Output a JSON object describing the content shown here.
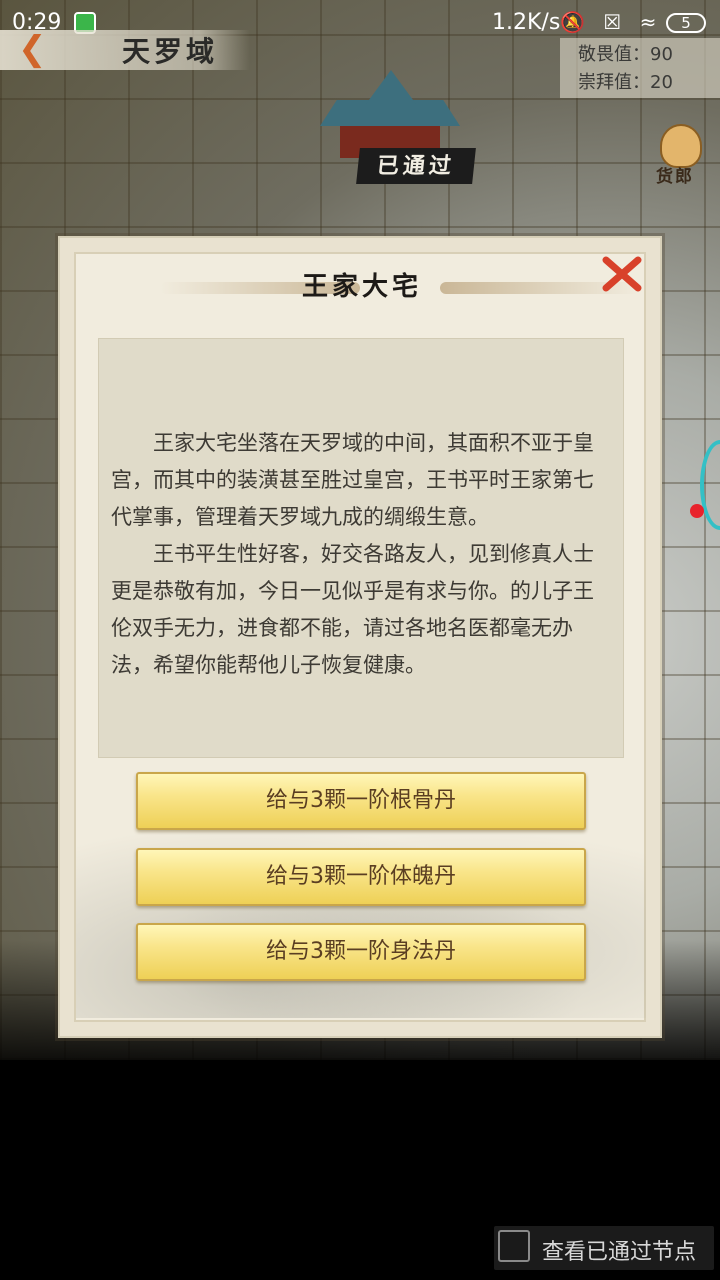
{
  "status_bar": {
    "time": "0:29",
    "network_speed": "1.2K/s",
    "icons": [
      "mute-bell",
      "sim-x",
      "wifi"
    ],
    "battery": "5"
  },
  "header": {
    "title": "天罗域"
  },
  "stats": {
    "awe": "敬畏值：90",
    "worship": "崇拜值：20"
  },
  "map": {
    "passed_tag": "已通过",
    "merchant_label": "货郎"
  },
  "dialog": {
    "title": "王家大宅",
    "paragraphs": [
      "王家大宅坐落在天罗域的中间，其面积不亚于皇宫，而其中的装潢甚至胜过皇宫，王书平时王家第七代掌事，管理着天罗域九成的绸缎生意。",
      "王书平生性好客，好交各路友人，见到修真人士更是恭敬有加，今日一见似乎是有求与你。的儿子王伦双手无力，进食都不能，请过各地名医都毫无办法，希望你能帮他儿子恢复健康。"
    ],
    "choices": [
      "给与3颗一阶根骨丹",
      "给与3颗一阶体魄丹",
      "给与3颗一阶身法丹"
    ]
  },
  "footer": {
    "toggle_label": "查看已通过节点"
  },
  "colors": {
    "accent_orange": "#d0652a",
    "close_red": "#d8412a",
    "button_gold": "#f9e58a"
  }
}
